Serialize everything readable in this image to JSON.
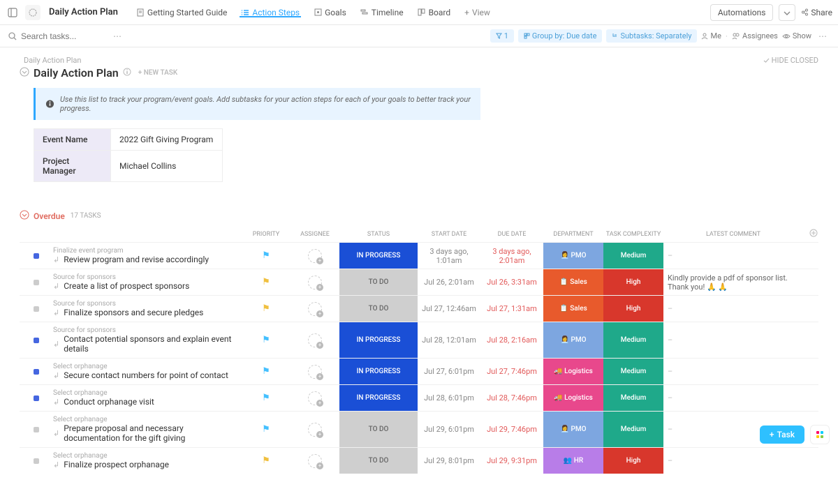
{
  "header": {
    "page_title": "Daily Action Plan",
    "automations_label": "Automations",
    "share_label": "Share",
    "tabs": [
      {
        "label": "Getting Started Guide"
      },
      {
        "label": "Action Steps"
      },
      {
        "label": "Goals"
      },
      {
        "label": "Timeline"
      },
      {
        "label": "Board"
      },
      {
        "label": "View"
      }
    ]
  },
  "toolbar": {
    "search_placeholder": "Search tasks...",
    "filter_count": "1",
    "group_by": "Group by: Due date",
    "subtasks": "Subtasks: Separately",
    "me": "Me",
    "assignees": "Assignees",
    "show": "Show"
  },
  "content": {
    "breadcrumb": "Daily Action Plan",
    "title": "Daily Action Plan",
    "new_task": "+ NEW TASK",
    "hide_closed": "HIDE CLOSED",
    "callout": "Use this list to track your program/event goals. Add subtasks for your action steps for each of your goals to better track your progress.",
    "info_table": {
      "event_name_label": "Event Name",
      "event_name_value": "2022 Gift Giving Program",
      "pm_label": "Project Manager",
      "pm_value": "Michael Collins"
    }
  },
  "group": {
    "name": "Overdue",
    "count": "17 TASKS"
  },
  "columns": {
    "priority": "PRIORITY",
    "assignee": "ASSIGNEE",
    "status": "STATUS",
    "start": "START DATE",
    "due": "DUE DATE",
    "dept": "DEPARTMENT",
    "complex": "TASK COMPLEXITY",
    "comment": "LATEST COMMENT"
  },
  "rows": [
    {
      "parent": "Finalize event program",
      "name": "Review program and revise accordingly",
      "sq": "blue",
      "flag": "blue",
      "status": "IN PROGRESS",
      "start": "3 days ago, 1:01am",
      "due": "3 days ago, 2:01am",
      "dept": "PMO",
      "dept_emoji": "👩‍💼",
      "complex": "Medium",
      "comment": "–"
    },
    {
      "parent": "Source for sponsors",
      "name": "Create a list of prospect sponsors",
      "sq": "gray",
      "flag": "yellow",
      "status": "TO DO",
      "start": "Jul 26, 2:01am",
      "due": "Jul 26, 3:31am",
      "dept": "Sales",
      "dept_emoji": "📋",
      "complex": "High",
      "comment": "Kindly provide a pdf of sponsor list. Thank you! 🙏 🙏"
    },
    {
      "parent": "Source for sponsors",
      "name": "Finalize sponsors and secure pledges",
      "sq": "gray",
      "flag": "yellow",
      "status": "TO DO",
      "start": "Jul 27, 12:46am",
      "due": "Jul 27, 1:31am",
      "dept": "Sales",
      "dept_emoji": "📋",
      "complex": "High",
      "comment": "–"
    },
    {
      "parent": "Source for sponsors",
      "name": "Contact potential sponsors and explain event details",
      "sq": "blue",
      "flag": "blue",
      "status": "IN PROGRESS",
      "start": "Jul 28, 12:01am",
      "due": "Jul 28, 2:16am",
      "dept": "PMO",
      "dept_emoji": "👩‍💼",
      "complex": "Medium",
      "comment": "–"
    },
    {
      "parent": "Select orphanage",
      "name": "Secure contact numbers for point of contact",
      "sq": "blue",
      "flag": "blue",
      "status": "IN PROGRESS",
      "start": "Jul 27, 6:01pm",
      "due": "Jul 27, 7:46pm",
      "dept": "Logistics",
      "dept_emoji": "🚚",
      "complex": "Medium",
      "comment": "–"
    },
    {
      "parent": "Select orphanage",
      "name": "Conduct orphanage visit",
      "sq": "blue",
      "flag": "blue",
      "status": "IN PROGRESS",
      "start": "Jul 28, 6:01pm",
      "due": "Jul 28, 7:46pm",
      "dept": "Logistics",
      "dept_emoji": "🚚",
      "complex": "Medium",
      "comment": "–"
    },
    {
      "parent": "Select orphanage",
      "name": "Prepare proposal and necessary documentation for the gift giving",
      "sq": "gray",
      "flag": "blue",
      "status": "TO DO",
      "start": "Jul 29, 6:01pm",
      "due": "Jul 29, 7:46pm",
      "dept": "PMO",
      "dept_emoji": "👩‍💼",
      "complex": "Medium",
      "comment": "–"
    },
    {
      "parent": "Select orphanage",
      "name": "Finalize prospect orphanage",
      "sq": "gray",
      "flag": "yellow",
      "status": "TO DO",
      "start": "Jul 29, 8:01pm",
      "due": "Jul 29, 9:31pm",
      "dept": "HR",
      "dept_emoji": "👥",
      "complex": "High",
      "comment": "–"
    }
  ],
  "fab": {
    "task": "Task"
  }
}
